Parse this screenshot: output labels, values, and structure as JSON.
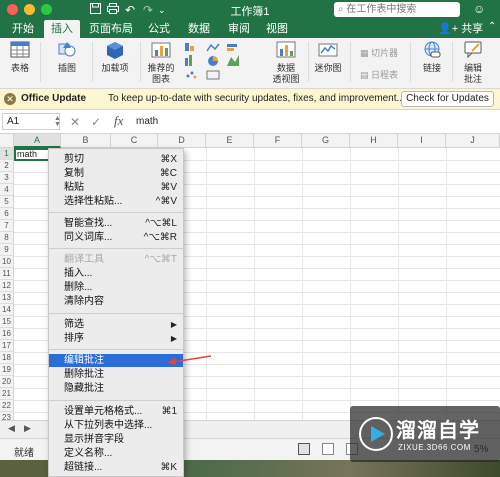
{
  "window": {
    "title": "工作簿1",
    "search_placeholder": "在工作表中搜索"
  },
  "ribbon_tabs": [
    "开始",
    "插入",
    "页面布局",
    "公式",
    "数据",
    "审阅",
    "视图"
  ],
  "active_tab": "插入",
  "share_label": "共享",
  "ribbon_buttons": {
    "table": "表格",
    "illustration": "插图",
    "addins": "加载项",
    "recommended_charts_1": "推荐的",
    "recommended_charts_2": "图表",
    "pivot_chart_1": "数据",
    "pivot_chart_2": "透视图",
    "sparklines": "迷你图",
    "slicer": "切片器",
    "timeline": "日程表",
    "link": "链接",
    "comment_1": "编辑",
    "comment_2": "批注"
  },
  "notification": {
    "title": "Office Update",
    "message": "To keep up-to-date with security updates, fixes, and improvement...",
    "button": "Check for Updates"
  },
  "formula_bar": {
    "name_box": "A1",
    "fx": "fx",
    "value": "math"
  },
  "columns": [
    "A",
    "B",
    "C",
    "D",
    "E",
    "F",
    "G",
    "H",
    "I",
    "J"
  ],
  "rows": [
    "1",
    "2",
    "3",
    "4",
    "5",
    "6",
    "7",
    "8",
    "9",
    "10",
    "11",
    "12",
    "13",
    "14",
    "15",
    "16",
    "17",
    "18",
    "19",
    "20",
    "21",
    "22",
    "23"
  ],
  "cell_a1": "math",
  "context_menu": {
    "cut": "剪切",
    "cut_sc": "⌘X",
    "copy": "复制",
    "copy_sc": "⌘C",
    "paste": "粘贴",
    "paste_sc": "⌘V",
    "paste_special": "选择性粘贴...",
    "paste_special_sc": "^⌘V",
    "smart_lookup": "智能查找...",
    "smart_lookup_sc": "^⌥⌘L",
    "thesaurus": "同义词库...",
    "thesaurus_sc": "^⌥⌘R",
    "translate": "翻译工具",
    "translate_sc": "^⌥⌘T",
    "insert": "插入...",
    "delete": "删除...",
    "clear": "清除内容",
    "filter": "筛选",
    "sort": "排序",
    "edit_comment": "编辑批注",
    "delete_comment": "删除批注",
    "hide_comment": "隐藏批注",
    "format_cells": "设置单元格格式...",
    "format_cells_sc": "⌘1",
    "pick_from_list": "从下拉列表中选择...",
    "phonetic": "显示拼音字段",
    "define_name": "定义名称...",
    "hyperlink": "超链接...",
    "hyperlink_sc": "⌘K"
  },
  "status": {
    "ready": "就绪",
    "zoom": "5%"
  },
  "watermark": {
    "name": "溜溜自学",
    "url": "ZIXUE.3D66.COM"
  },
  "colors": {
    "excel_green": "#217346",
    "menu_highlight": "#2a6dd6",
    "annotation_red": "#e0463a"
  }
}
